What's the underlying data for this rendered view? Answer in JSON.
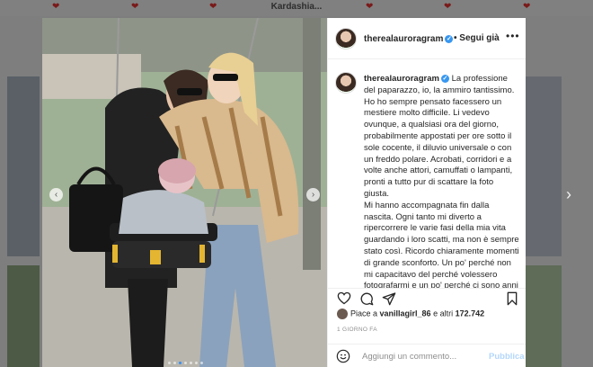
{
  "background": {
    "title": "Kardashia...",
    "heart_glyph": "❤"
  },
  "nav": {
    "next_glyph": "›"
  },
  "photo": {
    "prev_glyph": "‹",
    "next_glyph": "›"
  },
  "post": {
    "username": "therealauroragram",
    "verified_glyph": "✓",
    "follow_label": "Segui già",
    "more_glyph": "•••",
    "caption": [
      "La professione del paparazzo, io, la ammiro tantissimo. Ho ho sempre pensato facessero un mestiere molto difficile. Li vedevo ovunque, a qualsiasi ora del giorno, probabilmente appostati per ore sotto il sole cocente, il diluvio universale o con un freddo polare. Acrobati, corridori e a volte anche attori, camuffati o lampanti, pronti a tutto pur di scattare la foto giusta.",
      "Mi hanno accompagnata fin dalla nascita. Ogni tanto mi diverto a ripercorrere le varie fasi della mia vita guardando i loro scatti, ma non è sempre stato così. Ricordo chiaramente momenti di grande sconforto. Un po' perché non mi capacitavo del perché volessero fotografarmi e un po' perché ci sono anni in cui vorresti diventare"
    ],
    "likes": {
      "prefix": "Piace a ",
      "user": "vanillagirl_86",
      "middle": " e altri ",
      "count": "172.742"
    },
    "timestamp": "1 GIORNO FA",
    "comment": {
      "placeholder": "Aggiungi un commento...",
      "publish_label": "Pubblica"
    }
  },
  "icons": [
    "heart-icon",
    "comment-icon",
    "share-icon",
    "bookmark-icon",
    "emoji-icon",
    "close-icon"
  ],
  "colors": {
    "accent": "#3897f0",
    "publish_disabled": "#b3d7fb",
    "text": "#262626",
    "muted": "#8e8e8e"
  }
}
